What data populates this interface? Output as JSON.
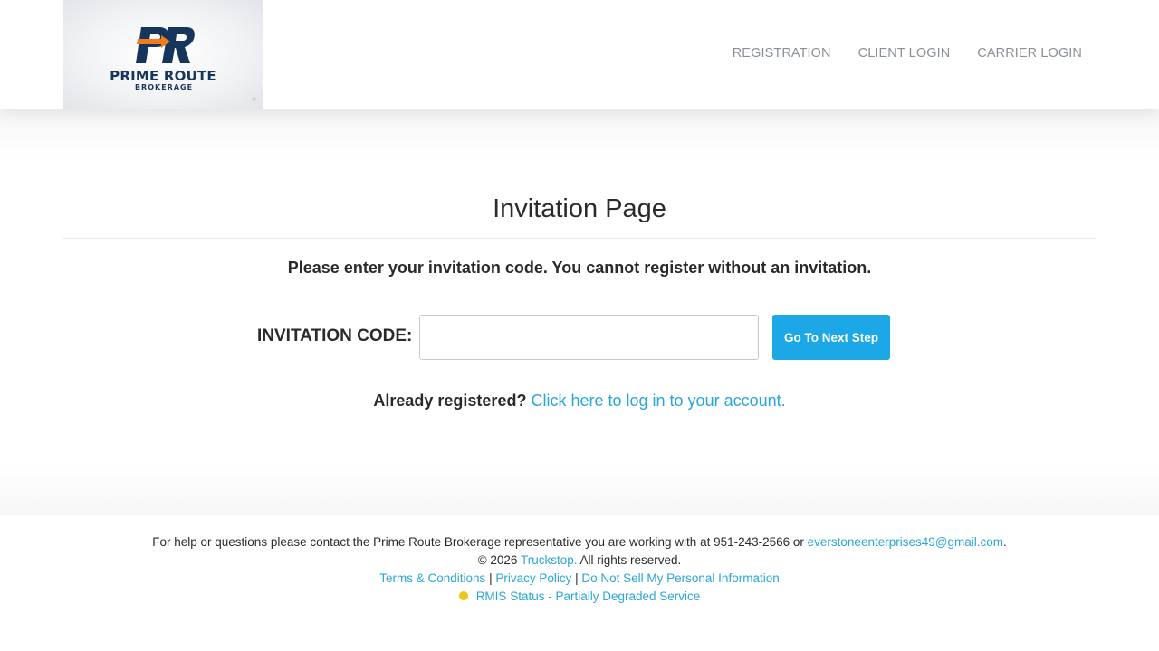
{
  "brand": {
    "name": "PRIME ROUTE",
    "subtitle": "BROKERAGE",
    "colors": {
      "navy": "#16355c",
      "orange": "#f07c1e"
    }
  },
  "nav": {
    "registration": "REGISTRATION",
    "client_login": "CLIENT LOGIN",
    "carrier_login": "CARRIER LOGIN"
  },
  "main": {
    "title": "Invitation Page",
    "instructions": "Please enter your invitation code. You cannot register without an invitation.",
    "code_label": "INVITATION CODE:",
    "code_value": "",
    "next_button": "Go To Next Step",
    "already_label": "Already registered?",
    "already_link": "Click here to log in to your account."
  },
  "footer": {
    "help_text": "For help or questions please contact the Prime Route Brokerage representative you are working with at 951-243-2566 or ",
    "email": "everstoneenterprises49@gmail.com",
    "help_end": ".",
    "copyright_prefix": "© 2026 ",
    "truckstop": "Truckstop.",
    "copyright_suffix": " All rights reserved.",
    "terms": "Terms & Conditions",
    "privacy": "Privacy Policy",
    "do_not_sell": "Do Not Sell My Personal Information",
    "separator": " | ",
    "status_text": "RMIS Status - Partially Degraded Service",
    "status_color": "#f0c419",
    "link_color": "#2aa6d6",
    "button_color": "#1ca8e6"
  }
}
